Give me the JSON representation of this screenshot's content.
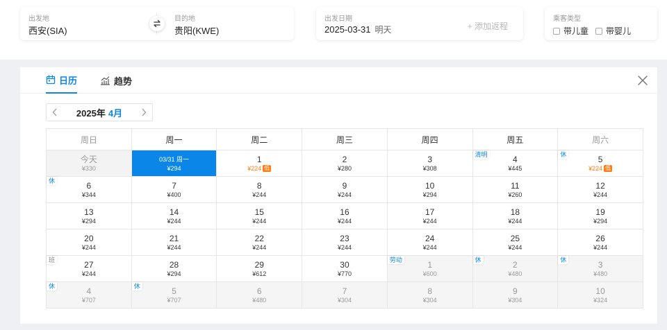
{
  "search": {
    "from_label": "出发地",
    "from_value": "西安(SIA)",
    "to_label": "目的地",
    "to_value": "贵阳(KWE)",
    "date_label": "出发日期",
    "date_value": "2025-03-31",
    "date_hint": "明天",
    "add_return": "+ 添加返程",
    "pax_label": "乘客类型",
    "pax_child": "带儿童",
    "pax_infant": "带婴儿"
  },
  "panel": {
    "tab_calendar": "日历",
    "tab_trend": "趋势",
    "year": "2025年",
    "month": "4月"
  },
  "colors": {
    "accent": "#0a86e8",
    "low": "#ff7d13"
  },
  "weekdays": [
    "周日",
    "周一",
    "周二",
    "周三",
    "周四",
    "周五",
    "周六"
  ],
  "weeks": [
    [
      {
        "day": "今天",
        "price": "¥330",
        "state": "past"
      },
      {
        "day": "03/31 周一",
        "price": "¥294",
        "state": "sel"
      },
      {
        "day": "1",
        "price": "¥224",
        "low": "低"
      },
      {
        "day": "2",
        "price": "¥280"
      },
      {
        "day": "3",
        "price": "¥308"
      },
      {
        "day": "4",
        "price": "¥445",
        "tag": "清明",
        "tag_type": "hol"
      },
      {
        "day": "5",
        "price": "¥224",
        "low": "低",
        "tag": "休",
        "tag_type": "rest"
      }
    ],
    [
      {
        "day": "6",
        "price": "¥344",
        "tag": "休",
        "tag_type": "rest"
      },
      {
        "day": "7",
        "price": "¥400"
      },
      {
        "day": "8",
        "price": "¥244"
      },
      {
        "day": "9",
        "price": "¥244"
      },
      {
        "day": "10",
        "price": "¥294"
      },
      {
        "day": "11",
        "price": "¥260"
      },
      {
        "day": "12",
        "price": "¥244"
      }
    ],
    [
      {
        "day": "13",
        "price": "¥294"
      },
      {
        "day": "14",
        "price": "¥244"
      },
      {
        "day": "15",
        "price": "¥244"
      },
      {
        "day": "16",
        "price": "¥244"
      },
      {
        "day": "17",
        "price": "¥244"
      },
      {
        "day": "18",
        "price": "¥244"
      },
      {
        "day": "19",
        "price": "¥294"
      }
    ],
    [
      {
        "day": "20",
        "price": "¥244"
      },
      {
        "day": "21",
        "price": "¥244"
      },
      {
        "day": "22",
        "price": "¥244"
      },
      {
        "day": "23",
        "price": "¥244"
      },
      {
        "day": "24",
        "price": "¥244"
      },
      {
        "day": "25",
        "price": "¥244"
      },
      {
        "day": "26",
        "price": "¥244"
      }
    ],
    [
      {
        "day": "27",
        "price": "¥244",
        "tag": "班",
        "tag_type": "work"
      },
      {
        "day": "28",
        "price": "¥294"
      },
      {
        "day": "29",
        "price": "¥612"
      },
      {
        "day": "30",
        "price": "¥770"
      },
      {
        "day": "1",
        "price": "¥600",
        "state": "next",
        "tag": "劳动",
        "tag_type": "hol"
      },
      {
        "day": "2",
        "price": "¥480",
        "state": "next",
        "tag": "休",
        "tag_type": "rest"
      },
      {
        "day": "3",
        "price": "¥480",
        "state": "next",
        "tag": "休",
        "tag_type": "rest"
      }
    ],
    [
      {
        "day": "4",
        "price": "¥707",
        "state": "next",
        "tag": "休",
        "tag_type": "rest"
      },
      {
        "day": "5",
        "price": "¥707",
        "state": "next",
        "tag": "休",
        "tag_type": "rest"
      },
      {
        "day": "6",
        "price": "¥480",
        "state": "next"
      },
      {
        "day": "7",
        "price": "¥304",
        "state": "next"
      },
      {
        "day": "8",
        "price": "¥304",
        "state": "next"
      },
      {
        "day": "9",
        "price": "¥304",
        "state": "next"
      },
      {
        "day": "10",
        "price": "¥324",
        "state": "next"
      }
    ]
  ]
}
